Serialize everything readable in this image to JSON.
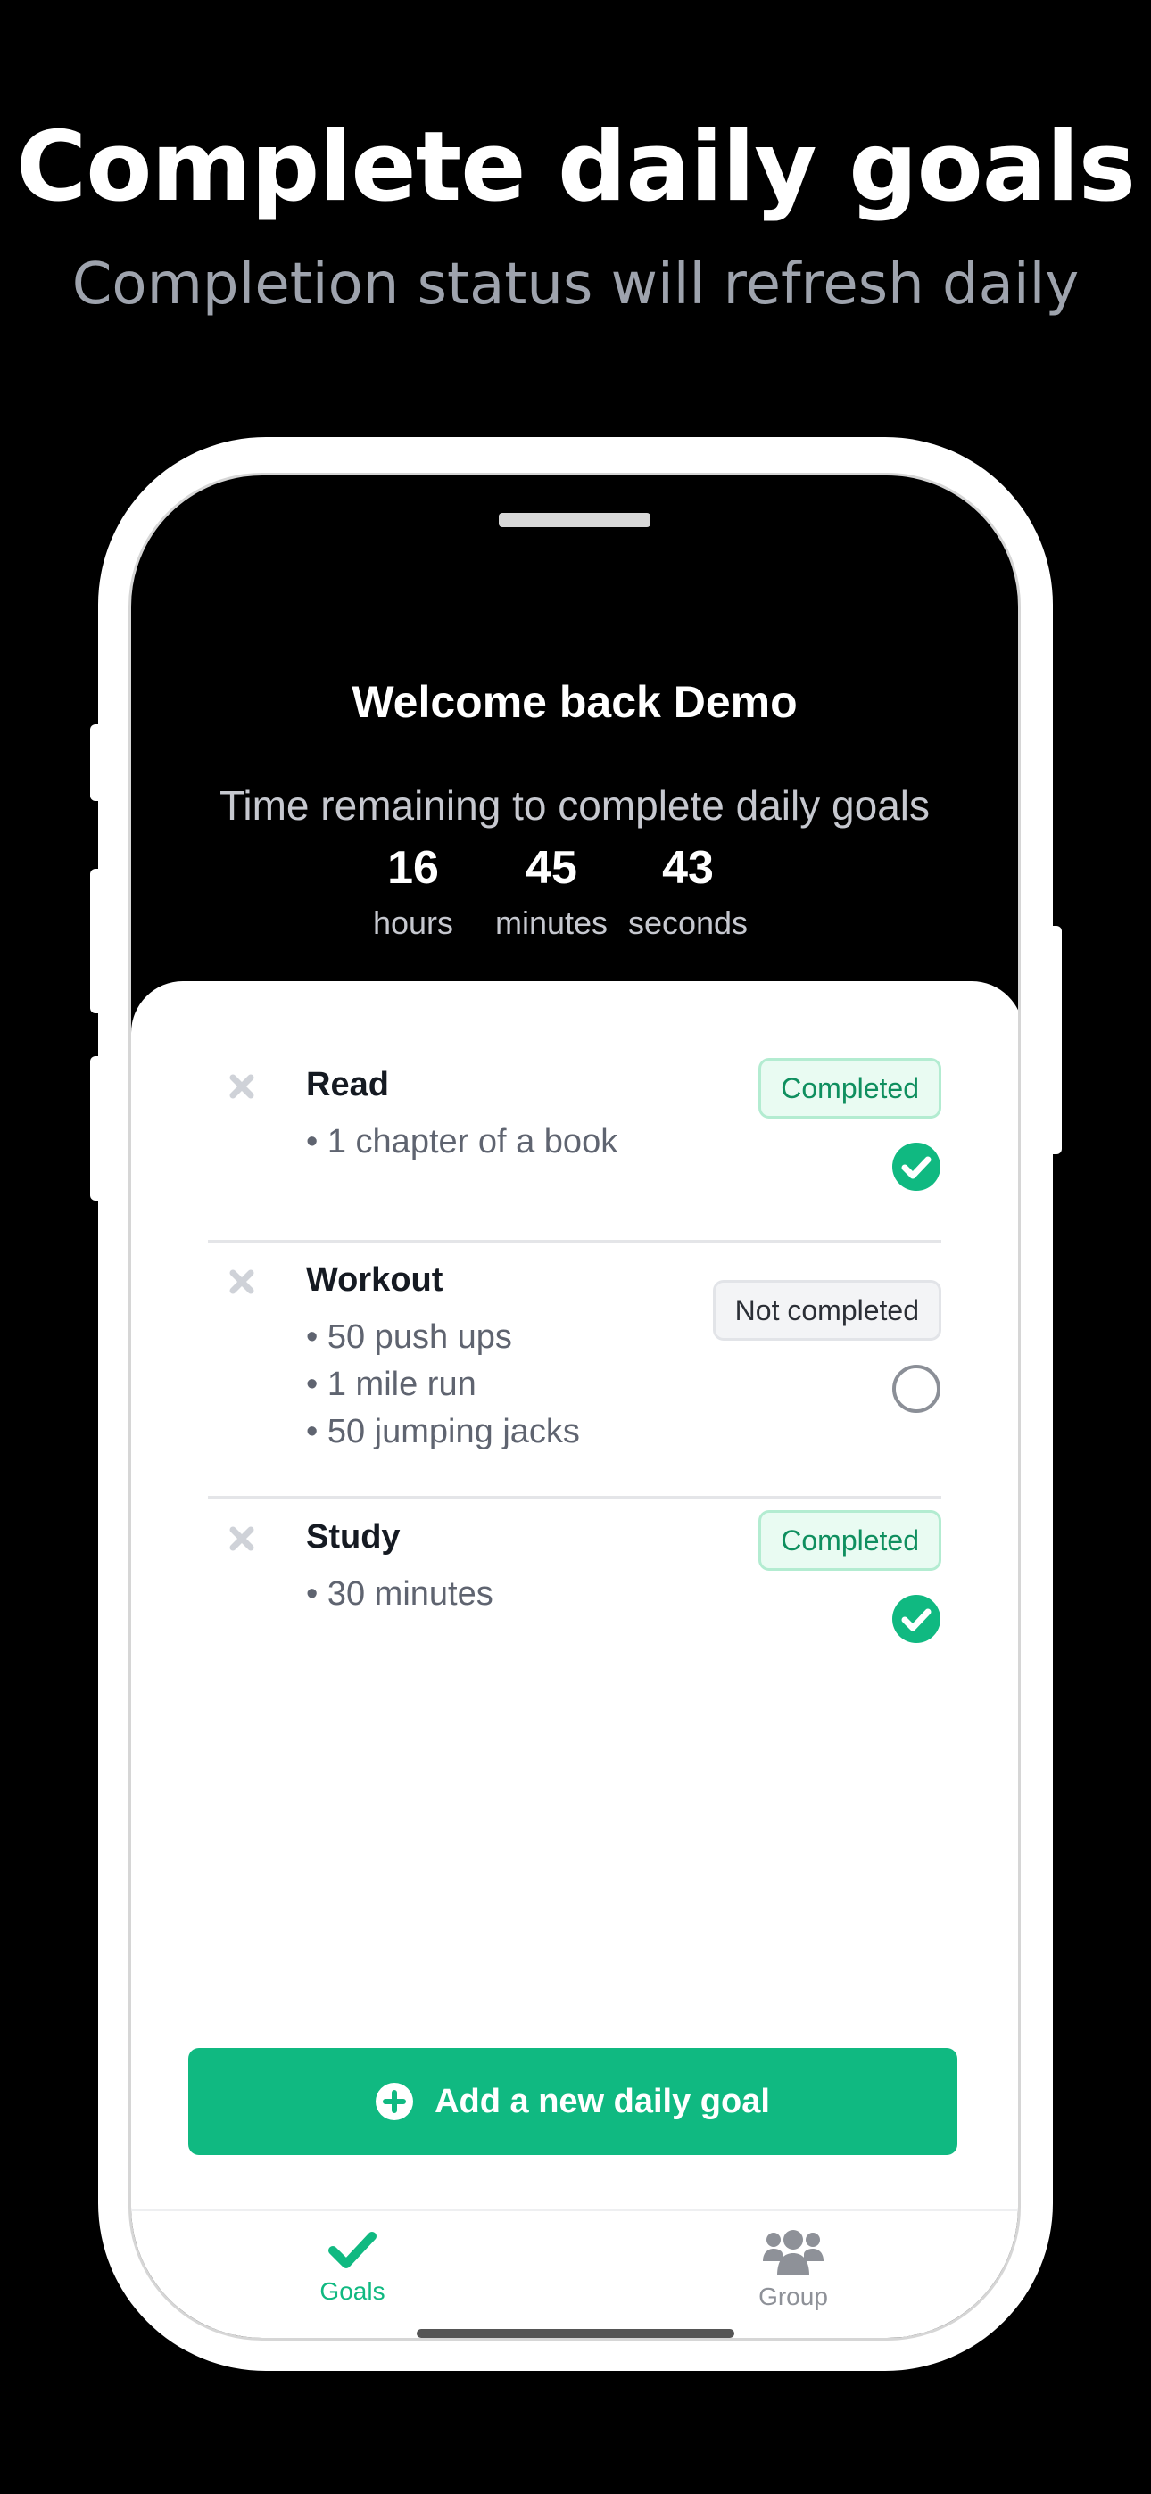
{
  "hero": {
    "title": "Complete daily goals",
    "subtitle": "Completion status will refresh daily"
  },
  "header": {
    "welcome": "Welcome back Demo",
    "time_caption": "Time remaining to complete daily goals",
    "countdown": {
      "hours": {
        "value": "16",
        "unit": "hours"
      },
      "minutes": {
        "value": "45",
        "unit": "minutes"
      },
      "seconds": {
        "value": "43",
        "unit": "seconds"
      }
    }
  },
  "goals": [
    {
      "name": "Read",
      "steps": [
        "• 1 chapter of a book"
      ],
      "status": "Completed",
      "completed": true
    },
    {
      "name": "Workout",
      "steps": [
        "• 50 push ups",
        "• 1 mile run",
        "• 50 jumping jacks"
      ],
      "status": "Not completed",
      "completed": false
    },
    {
      "name": "Study",
      "steps": [
        "• 30 minutes"
      ],
      "status": "Completed",
      "completed": true
    }
  ],
  "actions": {
    "add_goal_label": "Add a new daily goal",
    "icon": "plus-circle-icon"
  },
  "tabbar": {
    "tabs": [
      {
        "label": "Goals",
        "icon": "check-icon",
        "active": true
      },
      {
        "label": "Group",
        "icon": "users-icon",
        "active": false
      }
    ]
  },
  "colors": {
    "accent": "#10b981",
    "badge_done_text": "#0f8f5f",
    "badge_done_bg": "#e9fbf2",
    "remove_icon": "#cfd2d8",
    "inactive_tab": "#8e9198"
  }
}
